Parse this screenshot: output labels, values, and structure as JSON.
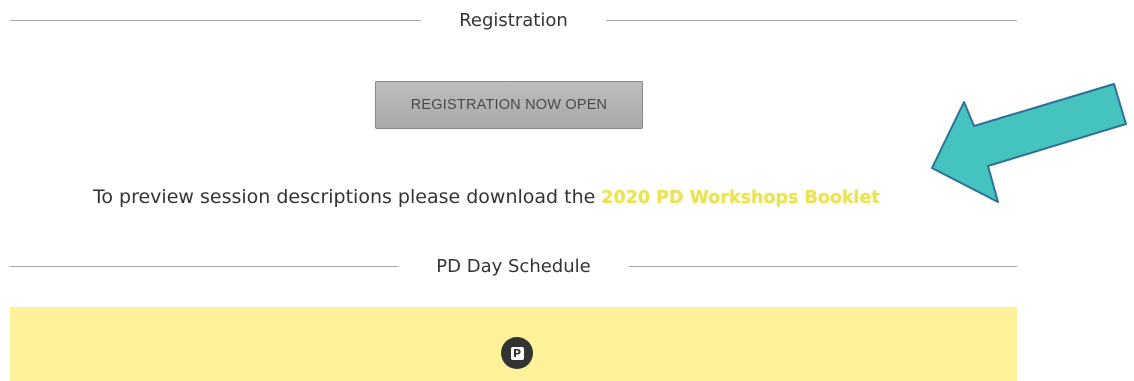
{
  "registration": {
    "heading": "Registration",
    "button_label": "REGISTRATION NOW OPEN"
  },
  "preview": {
    "text": "To preview session descriptions please download the ",
    "link_text": "2020 PD Workshops Booklet",
    "link_color": "#e8e35a"
  },
  "schedule": {
    "heading": "PD Day Schedule",
    "panel_color": "#fdf29a",
    "badge_letter": "P"
  },
  "annotation": {
    "arrow_color": "#45c4bf",
    "arrow_icon": "pointer-arrow-icon"
  }
}
